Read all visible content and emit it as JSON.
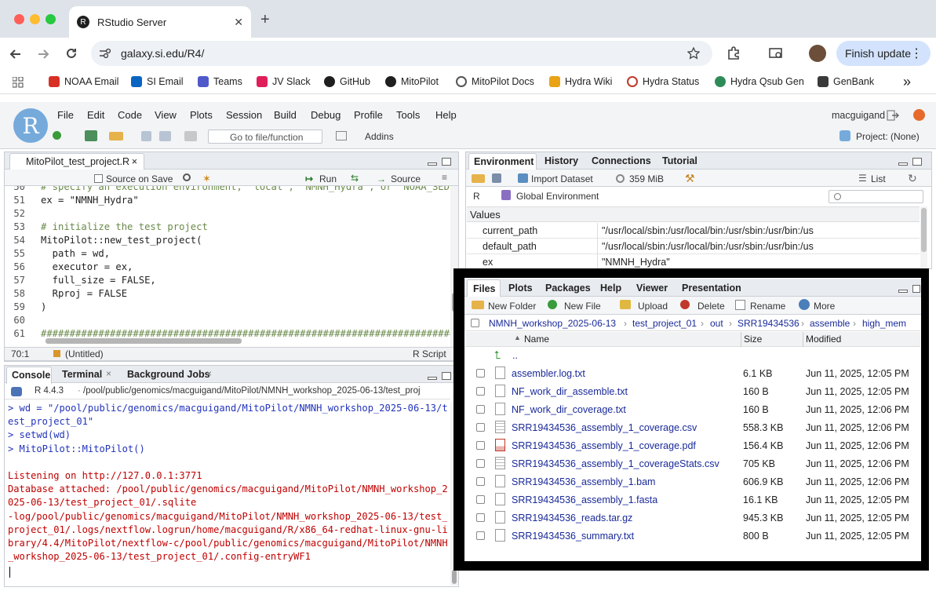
{
  "browser": {
    "tab_title": "RStudio Server",
    "tab_close": "✕",
    "new_tab": "+",
    "url": "galaxy.si.edu/R4/",
    "finish_update": "Finish update",
    "bookmarks": [
      {
        "label": "NOAA Email",
        "color": "#d93025"
      },
      {
        "label": "SI Email",
        "color": "#0a64c2"
      },
      {
        "label": "Teams",
        "color": "#5059c9"
      },
      {
        "label": "JV Slack",
        "color": "#e01e5a"
      },
      {
        "label": "GitHub",
        "color": "#1f1f1f"
      },
      {
        "label": "MitoPilot",
        "color": "#1f1f1f"
      },
      {
        "label": "MitoPilot Docs",
        "color": "#555555"
      },
      {
        "label": "Hydra Wiki",
        "color": "#e8a317"
      },
      {
        "label": "Hydra Status",
        "color": "#c0392b"
      },
      {
        "label": "Hydra Qsub Gen",
        "color": "#2e8b57"
      },
      {
        "label": "GenBank",
        "color": "#3a3a3a"
      }
    ],
    "bookmarks_more": "»"
  },
  "rstudio": {
    "menu": [
      "File",
      "Edit",
      "Code",
      "View",
      "Plots",
      "Session",
      "Build",
      "Debug",
      "Profile",
      "Tools",
      "Help"
    ],
    "user": "macguigand",
    "goto_placeholder": "Go to file/function",
    "addins": "Addins",
    "project": "Project: (None)"
  },
  "editor": {
    "tab_label": "MitoPilot_test_project.R",
    "source_on_save": "Source on Save",
    "run": "Run",
    "source": "Source",
    "lines": [
      {
        "n": "50",
        "text": "# specify an execution environment, 'local', 'NMNH_Hydra', or 'NOAA_SED",
        "cls": "cm"
      },
      {
        "n": "51",
        "text": "ex = \"NMNH_Hydra\"",
        "cls": ""
      },
      {
        "n": "52",
        "text": "",
        "cls": ""
      },
      {
        "n": "53",
        "text": "# initialize the test project",
        "cls": "cm"
      },
      {
        "n": "54",
        "text": "MitoPilot::new_test_project(",
        "cls": ""
      },
      {
        "n": "55",
        "text": "  path = wd,",
        "cls": ""
      },
      {
        "n": "56",
        "text": "  executor = ex,",
        "cls": ""
      },
      {
        "n": "57",
        "text": "  full_size = FALSE,",
        "cls": ""
      },
      {
        "n": "58",
        "text": "  Rproj = FALSE",
        "cls": ""
      },
      {
        "n": "59",
        "text": ")",
        "cls": ""
      },
      {
        "n": "60",
        "text": "",
        "cls": ""
      },
      {
        "n": "61",
        "text": "###########################################################################",
        "cls": "cm"
      }
    ],
    "status_pos": "70:1",
    "status_scope": "(Untitled)",
    "status_type": "R Script"
  },
  "console": {
    "tabs": [
      "Console",
      "Terminal",
      "Background Jobs"
    ],
    "r_version": "R 4.4.3",
    "path": "/pool/public/genomics/macguigand/MitoPilot/NMNH_workshop_2025-06-13/test_proj",
    "lines": [
      {
        "text": "> wd = \"/pool/public/genomics/macguigand/MitoPilot/NMNH_workshop_2025-06-13/t",
        "cls": "blue"
      },
      {
        "text": "est_project_01\"",
        "cls": "blue"
      },
      {
        "text": "> setwd(wd)",
        "cls": "blue"
      },
      {
        "text": "> MitoPilot::MitoPilot()",
        "cls": "blue"
      },
      {
        "text": "",
        "cls": ""
      },
      {
        "text": "Listening on http://127.0.0.1:3771",
        "cls": "red"
      },
      {
        "text": "Database attached: /pool/public/genomics/macguigand/MitoPilot/NMNH_workshop_2",
        "cls": "red"
      },
      {
        "text": "025-06-13/test_project_01/.sqlite",
        "cls": "red"
      },
      {
        "text": "-log/pool/public/genomics/macguigand/MitoPilot/NMNH_workshop_2025-06-13/test_",
        "cls": "red"
      },
      {
        "text": "project_01/.logs/nextflow.logrun/home/macguigand/R/x86_64-redhat-linux-gnu-li",
        "cls": "red"
      },
      {
        "text": "brary/4.4/MitoPilot/nextflow-c/pool/public/genomics/macguigand/MitoPilot/NMNH",
        "cls": "red"
      },
      {
        "text": "_workshop_2025-06-13/test_project_01/.config-entryWF1",
        "cls": "red"
      }
    ]
  },
  "environment": {
    "tabs": [
      "Environment",
      "History",
      "Connections",
      "Tutorial"
    ],
    "import_dataset": "Import Dataset",
    "memory": "359 MiB",
    "list": "List",
    "lang": "R",
    "scope": "Global Environment",
    "section": "Values",
    "rows": [
      {
        "name": "current_path",
        "value": "\"/usr/local/sbin:/usr/local/bin:/usr/sbin:/usr/bin:/us"
      },
      {
        "name": "default_path",
        "value": "\"/usr/local/sbin:/usr/local/bin:/usr/sbin:/usr/bin:/us"
      },
      {
        "name": "ex",
        "value": "\"NMNH_Hydra\""
      }
    ]
  },
  "files": {
    "tabs": [
      "Files",
      "Plots",
      "Packages",
      "Help",
      "Viewer",
      "Presentation"
    ],
    "actions": [
      "New Folder",
      "New File",
      "Upload",
      "Delete",
      "Rename",
      "More"
    ],
    "breadcrumb": [
      "NMNH_workshop_2025-06-13",
      "test_project_01",
      "out",
      "SRR19434536",
      "assemble",
      "high_mem"
    ],
    "columns": [
      "Name",
      "Size",
      "Modified"
    ],
    "parent": "..",
    "rows": [
      {
        "name": "assembler.log.txt",
        "size": "6.1 KB",
        "modified": "Jun 11, 2025, 12:05 PM",
        "icon": "doc"
      },
      {
        "name": "NF_work_dir_assemble.txt",
        "size": "160 B",
        "modified": "Jun 11, 2025, 12:05 PM",
        "icon": "doc"
      },
      {
        "name": "NF_work_dir_coverage.txt",
        "size": "160 B",
        "modified": "Jun 11, 2025, 12:06 PM",
        "icon": "doc"
      },
      {
        "name": "SRR19434536_assembly_1_coverage.csv",
        "size": "558.3 KB",
        "modified": "Jun 11, 2025, 12:06 PM",
        "icon": "grid"
      },
      {
        "name": "SRR19434536_assembly_1_coverage.pdf",
        "size": "156.4 KB",
        "modified": "Jun 11, 2025, 12:06 PM",
        "icon": "pdf"
      },
      {
        "name": "SRR19434536_assembly_1_coverageStats.csv",
        "size": "705 KB",
        "modified": "Jun 11, 2025, 12:06 PM",
        "icon": "grid"
      },
      {
        "name": "SRR19434536_assembly_1.bam",
        "size": "606.9 KB",
        "modified": "Jun 11, 2025, 12:06 PM",
        "icon": "doc"
      },
      {
        "name": "SRR19434536_assembly_1.fasta",
        "size": "16.1 KB",
        "modified": "Jun 11, 2025, 12:05 PM",
        "icon": "doc"
      },
      {
        "name": "SRR19434536_reads.tar.gz",
        "size": "945.3 KB",
        "modified": "Jun 11, 2025, 12:05 PM",
        "icon": "doc"
      },
      {
        "name": "SRR19434536_summary.txt",
        "size": "800 B",
        "modified": "Jun 11, 2025, 12:05 PM",
        "icon": "doc"
      }
    ]
  }
}
